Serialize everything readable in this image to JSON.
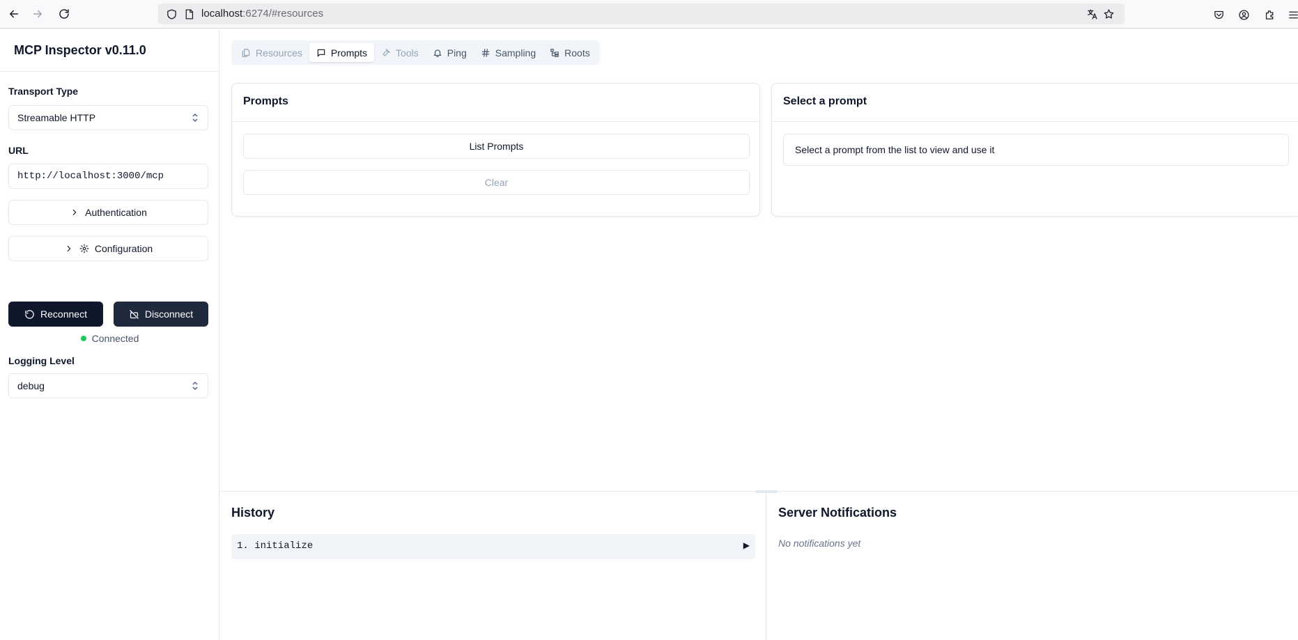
{
  "browser": {
    "url_host": "localhost",
    "url_rest": ":6274/#resources"
  },
  "sidebar": {
    "title": "MCP Inspector v0.11.0",
    "transport_label": "Transport Type",
    "transport_value": "Streamable HTTP",
    "url_label": "URL",
    "url_value": "http://localhost:3000/mcp",
    "auth_label": "Authentication",
    "config_label": "Configuration",
    "reconnect_label": "Reconnect",
    "disconnect_label": "Disconnect",
    "status_text": "Connected",
    "status_color": "#22c55e",
    "logging_label": "Logging Level",
    "logging_value": "debug"
  },
  "tabs": [
    {
      "label": "Resources",
      "icon": "files-icon",
      "state": "disabled"
    },
    {
      "label": "Prompts",
      "icon": "message-square-icon",
      "state": "active"
    },
    {
      "label": "Tools",
      "icon": "hammer-icon",
      "state": "disabled"
    },
    {
      "label": "Ping",
      "icon": "bell-icon",
      "state": "normal"
    },
    {
      "label": "Sampling",
      "icon": "hash-icon",
      "state": "normal"
    },
    {
      "label": "Roots",
      "icon": "folder-tree-icon",
      "state": "normal"
    }
  ],
  "prompts_card": {
    "title": "Prompts",
    "list_button": "List Prompts",
    "clear_button": "Clear"
  },
  "select_card": {
    "title": "Select a prompt",
    "hint": "Select a prompt from the list to view and use it"
  },
  "history": {
    "title": "History",
    "items": [
      {
        "label": "1. initialize"
      }
    ]
  },
  "notifications": {
    "title": "Server Notifications",
    "empty": "No notifications yet"
  }
}
